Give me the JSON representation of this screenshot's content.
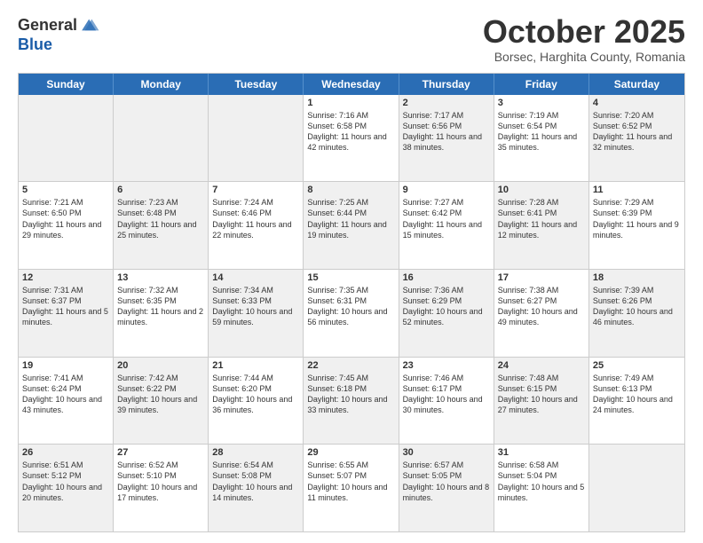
{
  "header": {
    "logo_line1": "General",
    "logo_line2": "Blue",
    "month": "October 2025",
    "location": "Borsec, Harghita County, Romania"
  },
  "days_of_week": [
    "Sunday",
    "Monday",
    "Tuesday",
    "Wednesday",
    "Thursday",
    "Friday",
    "Saturday"
  ],
  "weeks": [
    [
      {
        "day": "",
        "text": "",
        "shaded": true
      },
      {
        "day": "",
        "text": "",
        "shaded": true
      },
      {
        "day": "",
        "text": "",
        "shaded": true
      },
      {
        "day": "1",
        "text": "Sunrise: 7:16 AM\nSunset: 6:58 PM\nDaylight: 11 hours and 42 minutes.",
        "shaded": false
      },
      {
        "day": "2",
        "text": "Sunrise: 7:17 AM\nSunset: 6:56 PM\nDaylight: 11 hours and 38 minutes.",
        "shaded": true
      },
      {
        "day": "3",
        "text": "Sunrise: 7:19 AM\nSunset: 6:54 PM\nDaylight: 11 hours and 35 minutes.",
        "shaded": false
      },
      {
        "day": "4",
        "text": "Sunrise: 7:20 AM\nSunset: 6:52 PM\nDaylight: 11 hours and 32 minutes.",
        "shaded": true
      }
    ],
    [
      {
        "day": "5",
        "text": "Sunrise: 7:21 AM\nSunset: 6:50 PM\nDaylight: 11 hours and 29 minutes.",
        "shaded": false
      },
      {
        "day": "6",
        "text": "Sunrise: 7:23 AM\nSunset: 6:48 PM\nDaylight: 11 hours and 25 minutes.",
        "shaded": true
      },
      {
        "day": "7",
        "text": "Sunrise: 7:24 AM\nSunset: 6:46 PM\nDaylight: 11 hours and 22 minutes.",
        "shaded": false
      },
      {
        "day": "8",
        "text": "Sunrise: 7:25 AM\nSunset: 6:44 PM\nDaylight: 11 hours and 19 minutes.",
        "shaded": true
      },
      {
        "day": "9",
        "text": "Sunrise: 7:27 AM\nSunset: 6:42 PM\nDaylight: 11 hours and 15 minutes.",
        "shaded": false
      },
      {
        "day": "10",
        "text": "Sunrise: 7:28 AM\nSunset: 6:41 PM\nDaylight: 11 hours and 12 minutes.",
        "shaded": true
      },
      {
        "day": "11",
        "text": "Sunrise: 7:29 AM\nSunset: 6:39 PM\nDaylight: 11 hours and 9 minutes.",
        "shaded": false
      }
    ],
    [
      {
        "day": "12",
        "text": "Sunrise: 7:31 AM\nSunset: 6:37 PM\nDaylight: 11 hours and 5 minutes.",
        "shaded": true
      },
      {
        "day": "13",
        "text": "Sunrise: 7:32 AM\nSunset: 6:35 PM\nDaylight: 11 hours and 2 minutes.",
        "shaded": false
      },
      {
        "day": "14",
        "text": "Sunrise: 7:34 AM\nSunset: 6:33 PM\nDaylight: 10 hours and 59 minutes.",
        "shaded": true
      },
      {
        "day": "15",
        "text": "Sunrise: 7:35 AM\nSunset: 6:31 PM\nDaylight: 10 hours and 56 minutes.",
        "shaded": false
      },
      {
        "day": "16",
        "text": "Sunrise: 7:36 AM\nSunset: 6:29 PM\nDaylight: 10 hours and 52 minutes.",
        "shaded": true
      },
      {
        "day": "17",
        "text": "Sunrise: 7:38 AM\nSunset: 6:27 PM\nDaylight: 10 hours and 49 minutes.",
        "shaded": false
      },
      {
        "day": "18",
        "text": "Sunrise: 7:39 AM\nSunset: 6:26 PM\nDaylight: 10 hours and 46 minutes.",
        "shaded": true
      }
    ],
    [
      {
        "day": "19",
        "text": "Sunrise: 7:41 AM\nSunset: 6:24 PM\nDaylight: 10 hours and 43 minutes.",
        "shaded": false
      },
      {
        "day": "20",
        "text": "Sunrise: 7:42 AM\nSunset: 6:22 PM\nDaylight: 10 hours and 39 minutes.",
        "shaded": true
      },
      {
        "day": "21",
        "text": "Sunrise: 7:44 AM\nSunset: 6:20 PM\nDaylight: 10 hours and 36 minutes.",
        "shaded": false
      },
      {
        "day": "22",
        "text": "Sunrise: 7:45 AM\nSunset: 6:18 PM\nDaylight: 10 hours and 33 minutes.",
        "shaded": true
      },
      {
        "day": "23",
        "text": "Sunrise: 7:46 AM\nSunset: 6:17 PM\nDaylight: 10 hours and 30 minutes.",
        "shaded": false
      },
      {
        "day": "24",
        "text": "Sunrise: 7:48 AM\nSunset: 6:15 PM\nDaylight: 10 hours and 27 minutes.",
        "shaded": true
      },
      {
        "day": "25",
        "text": "Sunrise: 7:49 AM\nSunset: 6:13 PM\nDaylight: 10 hours and 24 minutes.",
        "shaded": false
      }
    ],
    [
      {
        "day": "26",
        "text": "Sunrise: 6:51 AM\nSunset: 5:12 PM\nDaylight: 10 hours and 20 minutes.",
        "shaded": true
      },
      {
        "day": "27",
        "text": "Sunrise: 6:52 AM\nSunset: 5:10 PM\nDaylight: 10 hours and 17 minutes.",
        "shaded": false
      },
      {
        "day": "28",
        "text": "Sunrise: 6:54 AM\nSunset: 5:08 PM\nDaylight: 10 hours and 14 minutes.",
        "shaded": true
      },
      {
        "day": "29",
        "text": "Sunrise: 6:55 AM\nSunset: 5:07 PM\nDaylight: 10 hours and 11 minutes.",
        "shaded": false
      },
      {
        "day": "30",
        "text": "Sunrise: 6:57 AM\nSunset: 5:05 PM\nDaylight: 10 hours and 8 minutes.",
        "shaded": true
      },
      {
        "day": "31",
        "text": "Sunrise: 6:58 AM\nSunset: 5:04 PM\nDaylight: 10 hours and 5 minutes.",
        "shaded": false
      },
      {
        "day": "",
        "text": "",
        "shaded": true
      }
    ]
  ]
}
